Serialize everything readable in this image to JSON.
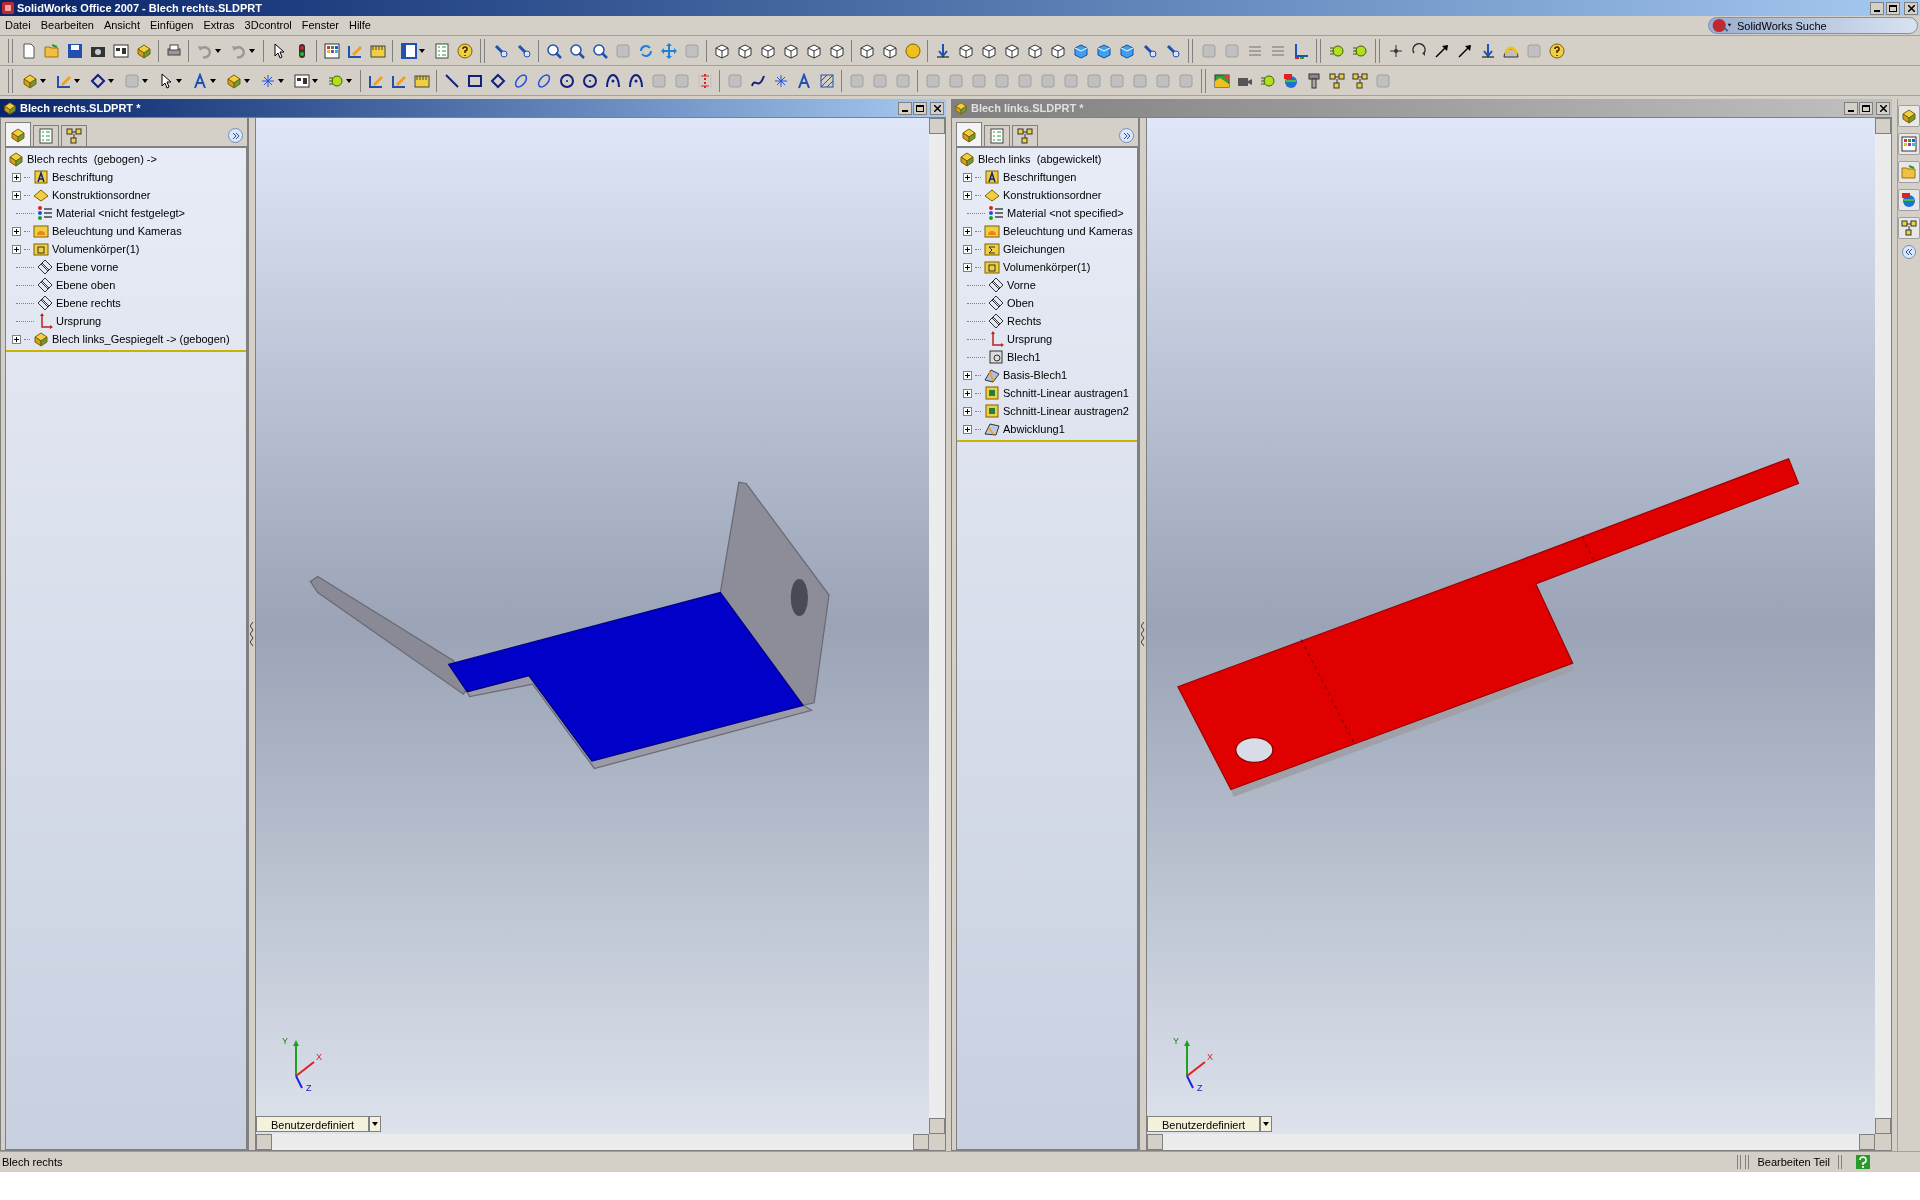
{
  "app": {
    "title": "SolidWorks Office 2007 - Blech rechts.SLDPRT"
  },
  "menu": [
    "Datei",
    "Bearbeiten",
    "Ansicht",
    "Einfügen",
    "Extras",
    "3Dcontrol",
    "Fenster",
    "Hilfe"
  ],
  "search": {
    "placeholder": "SolidWorks Suche"
  },
  "documents": [
    {
      "title": "Blech rechts.SLDPRT *",
      "active": true,
      "kind": "bent",
      "view_mode": "Benutzerdefiniert",
      "triad": [
        "Y",
        "X",
        "Z"
      ],
      "tree_tabs": [
        {
          "kind": "features",
          "selected": true
        },
        {
          "kind": "properties",
          "selected": false
        },
        {
          "kind": "configurations",
          "selected": false
        }
      ],
      "tree": {
        "label": "Blech rechts  (gebogen) ->",
        "kind": "part",
        "children": [
          {
            "label": "Beschriftung",
            "kind": "annotations",
            "expandable": true
          },
          {
            "label": "Konstruktionsordner",
            "kind": "design",
            "expandable": true
          },
          {
            "label": "Material <nicht festgelegt>",
            "kind": "material",
            "expandable": false
          },
          {
            "label": "Beleuchtung und Kameras",
            "kind": "lights",
            "expandable": true
          },
          {
            "label": "Volumenkörper(1)",
            "kind": "bodies",
            "expandable": true
          },
          {
            "label": "Ebene vorne",
            "kind": "plane",
            "expandable": false
          },
          {
            "label": "Ebene oben",
            "kind": "plane",
            "expandable": false
          },
          {
            "label": "Ebene rechts",
            "kind": "plane",
            "expandable": false
          },
          {
            "label": "Ursprung",
            "kind": "origin",
            "expandable": false
          },
          {
            "label": "Blech links_Gespiegelt -> (gebogen)",
            "kind": "part",
            "expandable": true
          }
        ]
      }
    },
    {
      "title": "Blech links.SLDPRT *",
      "active": false,
      "kind": "flat",
      "view_mode": "Benutzerdefiniert",
      "triad": [
        "Y",
        "X",
        "Z"
      ],
      "tree_tabs": [
        {
          "kind": "features",
          "selected": true
        },
        {
          "kind": "properties",
          "selected": false
        },
        {
          "kind": "configurations",
          "selected": false
        }
      ],
      "tree": {
        "label": "Blech links  (abgewickelt)",
        "kind": "part",
        "children": [
          {
            "label": "Beschriftungen",
            "kind": "annotations",
            "expandable": true
          },
          {
            "label": "Konstruktionsordner",
            "kind": "design",
            "expandable": true
          },
          {
            "label": "Material <not specified>",
            "kind": "material",
            "expandable": false
          },
          {
            "label": "Beleuchtung und Kameras",
            "kind": "lights",
            "expandable": true
          },
          {
            "label": "Gleichungen",
            "kind": "equations",
            "expandable": true
          },
          {
            "label": "Volumenkörper(1)",
            "kind": "bodies",
            "expandable": true
          },
          {
            "label": "Vorne",
            "kind": "plane",
            "expandable": false
          },
          {
            "label": "Oben",
            "kind": "plane",
            "expandable": false
          },
          {
            "label": "Rechts",
            "kind": "plane",
            "expandable": false
          },
          {
            "label": "Ursprung",
            "kind": "origin",
            "expandable": false
          },
          {
            "label": "Blech1",
            "kind": "sheetmetal",
            "expandable": false
          },
          {
            "label": "Basis-Blech1",
            "kind": "baseflange",
            "expandable": true
          },
          {
            "label": "Schnitt-Linear austragen1",
            "kind": "cut",
            "expandable": true
          },
          {
            "label": "Schnitt-Linear austragen2",
            "kind": "cut",
            "expandable": true
          },
          {
            "label": "Abwicklung1",
            "kind": "flatten",
            "expandable": true
          }
        ]
      }
    }
  ],
  "status_bar": {
    "text": "Blech rechts",
    "mode": "Bearbeiten Teil"
  }
}
